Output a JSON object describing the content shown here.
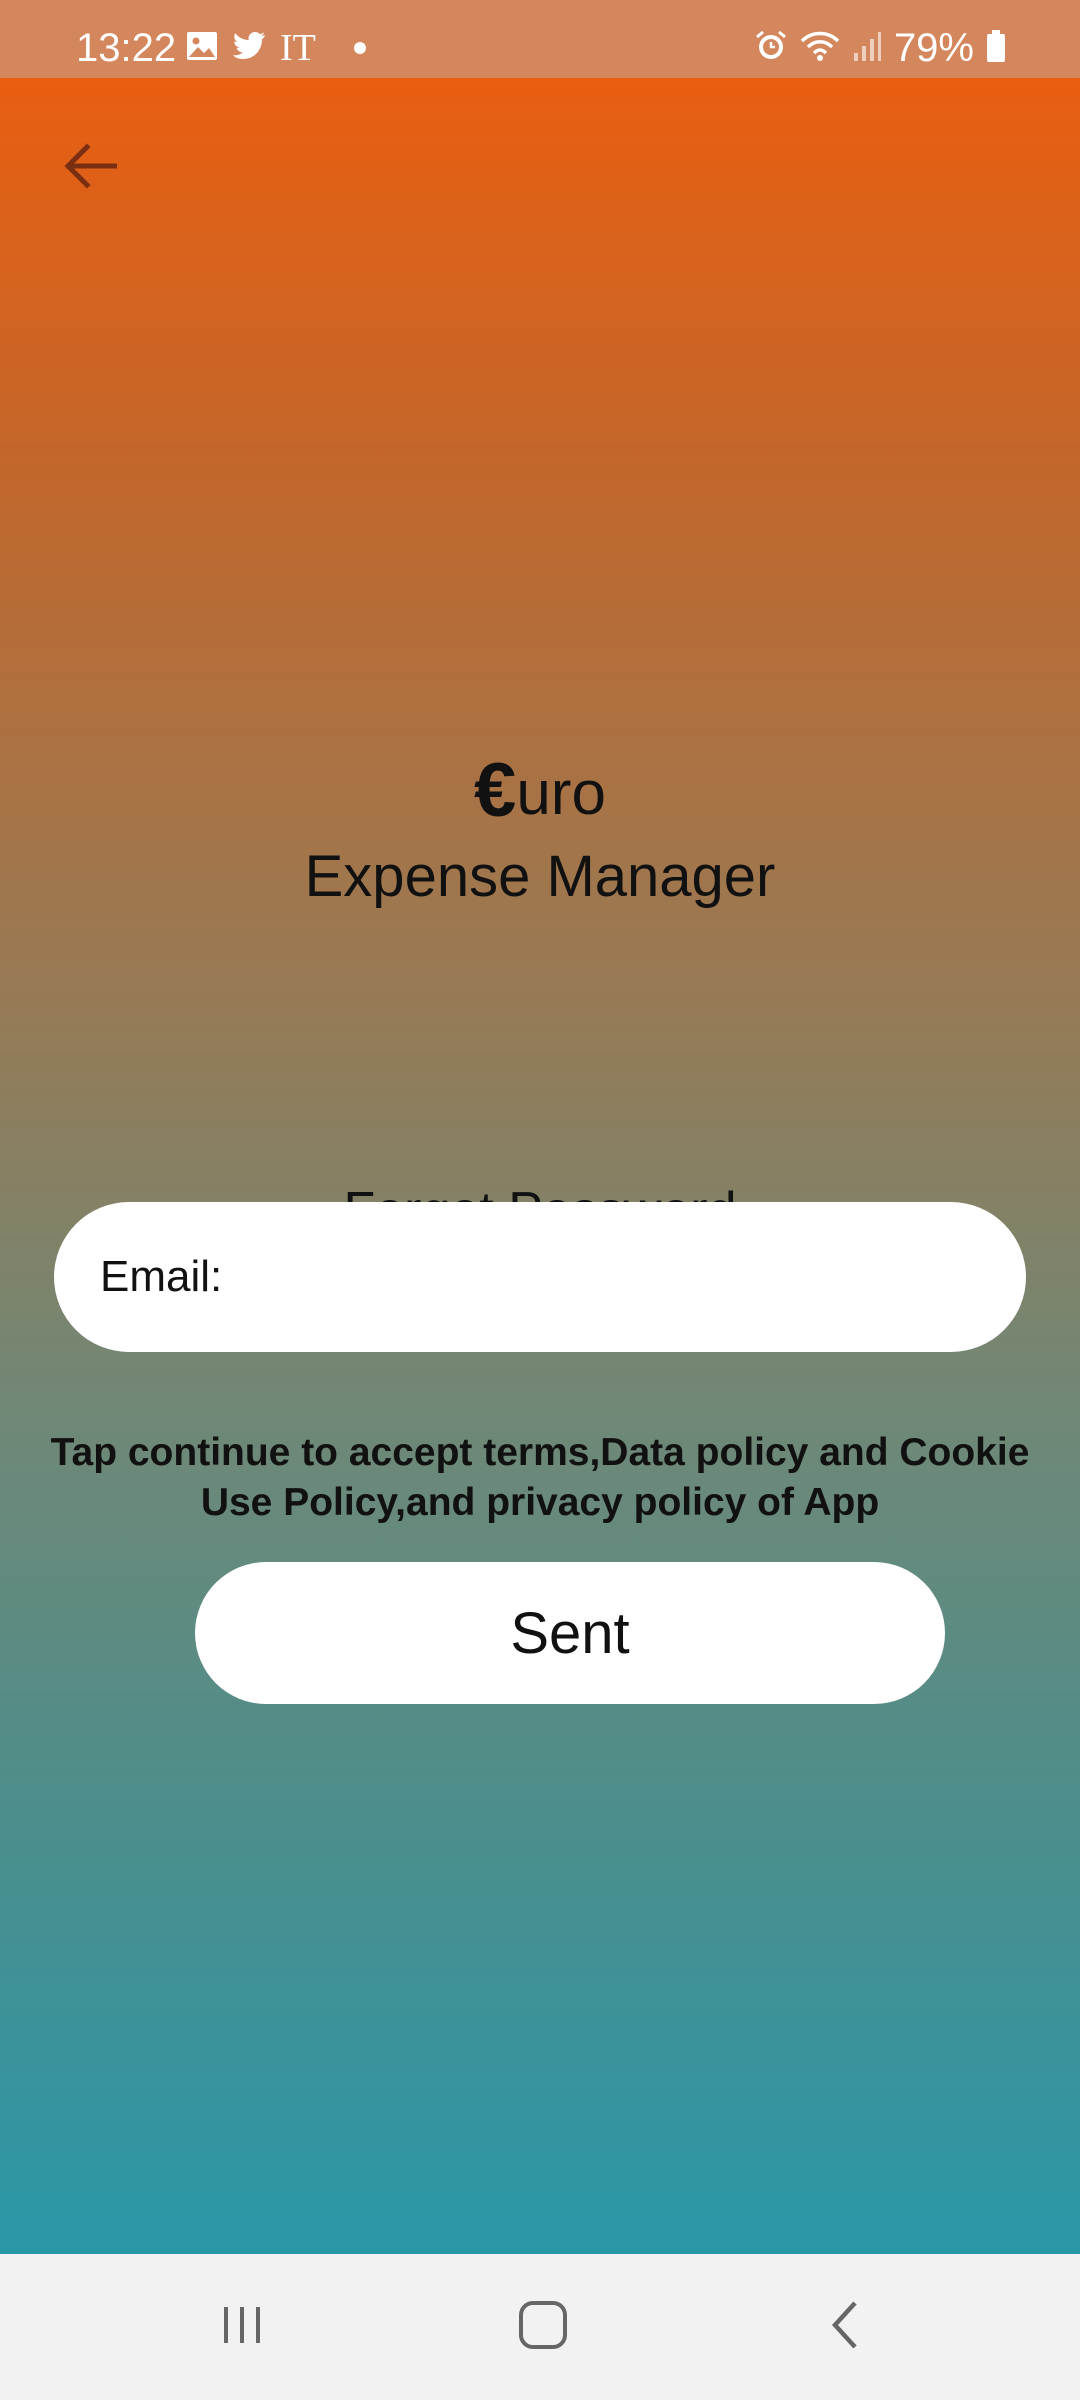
{
  "status_bar": {
    "time": "13:22",
    "carrier": "IT",
    "battery": "79%",
    "icons": [
      "gallery-icon",
      "twitter-icon",
      "alarm-icon",
      "wifi-icon",
      "signal-icon",
      "battery-icon"
    ]
  },
  "app": {
    "brand_symbol": "€",
    "brand_rest": "uro",
    "brand_subtitle": "Expense Manager",
    "heading": "Forgot Password",
    "email_label": "Email:",
    "email_value": "",
    "terms_line1": "Tap continue to accept terms,Data policy and Cookie",
    "terms_line2": "Use Policy,and privacy policy of App",
    "submit_label": "Sent"
  },
  "colors": {
    "gradient_top": "#e95e10",
    "gradient_bottom": "#2a97a8",
    "status_bar": "#d4875c",
    "back_arrow": "#7a2e12"
  },
  "nav_bar": {
    "buttons": [
      "recent-apps-icon",
      "home-icon",
      "back-icon"
    ]
  }
}
